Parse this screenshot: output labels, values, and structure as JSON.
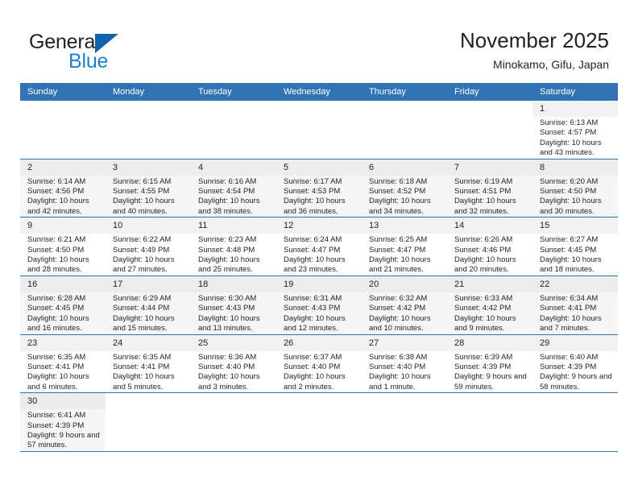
{
  "brand": {
    "name_part1": "General",
    "name_part2": "Blue",
    "triangle_color": "#1263ad",
    "blue_color": "#1f7fd4"
  },
  "header": {
    "title": "November 2025",
    "subtitle": "Minokamo, Gifu, Japan"
  },
  "theme": {
    "header_row_bg": "#3174b6",
    "row_border": "#3174b6",
    "alt_row_bg": "#f5f5f5",
    "daynum_bg": "#f1f1f1",
    "text": "#231f20"
  },
  "calendar": {
    "weekday_headers": [
      "Sunday",
      "Monday",
      "Tuesday",
      "Wednesday",
      "Thursday",
      "Friday",
      "Saturday"
    ],
    "weeks": [
      [
        {
          "empty": true
        },
        {
          "empty": true
        },
        {
          "empty": true
        },
        {
          "empty": true
        },
        {
          "empty": true
        },
        {
          "empty": true
        },
        {
          "day": "1",
          "sunrise": "Sunrise: 6:13 AM",
          "sunset": "Sunset: 4:57 PM",
          "daylight": "Daylight: 10 hours and 43 minutes."
        }
      ],
      [
        {
          "day": "2",
          "sunrise": "Sunrise: 6:14 AM",
          "sunset": "Sunset: 4:56 PM",
          "daylight": "Daylight: 10 hours and 42 minutes."
        },
        {
          "day": "3",
          "sunrise": "Sunrise: 6:15 AM",
          "sunset": "Sunset: 4:55 PM",
          "daylight": "Daylight: 10 hours and 40 minutes."
        },
        {
          "day": "4",
          "sunrise": "Sunrise: 6:16 AM",
          "sunset": "Sunset: 4:54 PM",
          "daylight": "Daylight: 10 hours and 38 minutes."
        },
        {
          "day": "5",
          "sunrise": "Sunrise: 6:17 AM",
          "sunset": "Sunset: 4:53 PM",
          "daylight": "Daylight: 10 hours and 36 minutes."
        },
        {
          "day": "6",
          "sunrise": "Sunrise: 6:18 AM",
          "sunset": "Sunset: 4:52 PM",
          "daylight": "Daylight: 10 hours and 34 minutes."
        },
        {
          "day": "7",
          "sunrise": "Sunrise: 6:19 AM",
          "sunset": "Sunset: 4:51 PM",
          "daylight": "Daylight: 10 hours and 32 minutes."
        },
        {
          "day": "8",
          "sunrise": "Sunrise: 6:20 AM",
          "sunset": "Sunset: 4:50 PM",
          "daylight": "Daylight: 10 hours and 30 minutes."
        }
      ],
      [
        {
          "day": "9",
          "sunrise": "Sunrise: 6:21 AM",
          "sunset": "Sunset: 4:50 PM",
          "daylight": "Daylight: 10 hours and 28 minutes."
        },
        {
          "day": "10",
          "sunrise": "Sunrise: 6:22 AM",
          "sunset": "Sunset: 4:49 PM",
          "daylight": "Daylight: 10 hours and 27 minutes."
        },
        {
          "day": "11",
          "sunrise": "Sunrise: 6:23 AM",
          "sunset": "Sunset: 4:48 PM",
          "daylight": "Daylight: 10 hours and 25 minutes."
        },
        {
          "day": "12",
          "sunrise": "Sunrise: 6:24 AM",
          "sunset": "Sunset: 4:47 PM",
          "daylight": "Daylight: 10 hours and 23 minutes."
        },
        {
          "day": "13",
          "sunrise": "Sunrise: 6:25 AM",
          "sunset": "Sunset: 4:47 PM",
          "daylight": "Daylight: 10 hours and 21 minutes."
        },
        {
          "day": "14",
          "sunrise": "Sunrise: 6:26 AM",
          "sunset": "Sunset: 4:46 PM",
          "daylight": "Daylight: 10 hours and 20 minutes."
        },
        {
          "day": "15",
          "sunrise": "Sunrise: 6:27 AM",
          "sunset": "Sunset: 4:45 PM",
          "daylight": "Daylight: 10 hours and 18 minutes."
        }
      ],
      [
        {
          "day": "16",
          "sunrise": "Sunrise: 6:28 AM",
          "sunset": "Sunset: 4:45 PM",
          "daylight": "Daylight: 10 hours and 16 minutes."
        },
        {
          "day": "17",
          "sunrise": "Sunrise: 6:29 AM",
          "sunset": "Sunset: 4:44 PM",
          "daylight": "Daylight: 10 hours and 15 minutes."
        },
        {
          "day": "18",
          "sunrise": "Sunrise: 6:30 AM",
          "sunset": "Sunset: 4:43 PM",
          "daylight": "Daylight: 10 hours and 13 minutes."
        },
        {
          "day": "19",
          "sunrise": "Sunrise: 6:31 AM",
          "sunset": "Sunset: 4:43 PM",
          "daylight": "Daylight: 10 hours and 12 minutes."
        },
        {
          "day": "20",
          "sunrise": "Sunrise: 6:32 AM",
          "sunset": "Sunset: 4:42 PM",
          "daylight": "Daylight: 10 hours and 10 minutes."
        },
        {
          "day": "21",
          "sunrise": "Sunrise: 6:33 AM",
          "sunset": "Sunset: 4:42 PM",
          "daylight": "Daylight: 10 hours and 9 minutes."
        },
        {
          "day": "22",
          "sunrise": "Sunrise: 6:34 AM",
          "sunset": "Sunset: 4:41 PM",
          "daylight": "Daylight: 10 hours and 7 minutes."
        }
      ],
      [
        {
          "day": "23",
          "sunrise": "Sunrise: 6:35 AM",
          "sunset": "Sunset: 4:41 PM",
          "daylight": "Daylight: 10 hours and 6 minutes."
        },
        {
          "day": "24",
          "sunrise": "Sunrise: 6:35 AM",
          "sunset": "Sunset: 4:41 PM",
          "daylight": "Daylight: 10 hours and 5 minutes."
        },
        {
          "day": "25",
          "sunrise": "Sunrise: 6:36 AM",
          "sunset": "Sunset: 4:40 PM",
          "daylight": "Daylight: 10 hours and 3 minutes."
        },
        {
          "day": "26",
          "sunrise": "Sunrise: 6:37 AM",
          "sunset": "Sunset: 4:40 PM",
          "daylight": "Daylight: 10 hours and 2 minutes."
        },
        {
          "day": "27",
          "sunrise": "Sunrise: 6:38 AM",
          "sunset": "Sunset: 4:40 PM",
          "daylight": "Daylight: 10 hours and 1 minute."
        },
        {
          "day": "28",
          "sunrise": "Sunrise: 6:39 AM",
          "sunset": "Sunset: 4:39 PM",
          "daylight": "Daylight: 9 hours and 59 minutes."
        },
        {
          "day": "29",
          "sunrise": "Sunrise: 6:40 AM",
          "sunset": "Sunset: 4:39 PM",
          "daylight": "Daylight: 9 hours and 58 minutes."
        }
      ],
      [
        {
          "day": "30",
          "sunrise": "Sunrise: 6:41 AM",
          "sunset": "Sunset: 4:39 PM",
          "daylight": "Daylight: 9 hours and 57 minutes."
        },
        {
          "empty": true
        },
        {
          "empty": true
        },
        {
          "empty": true
        },
        {
          "empty": true
        },
        {
          "empty": true
        },
        {
          "empty": true
        }
      ]
    ]
  }
}
